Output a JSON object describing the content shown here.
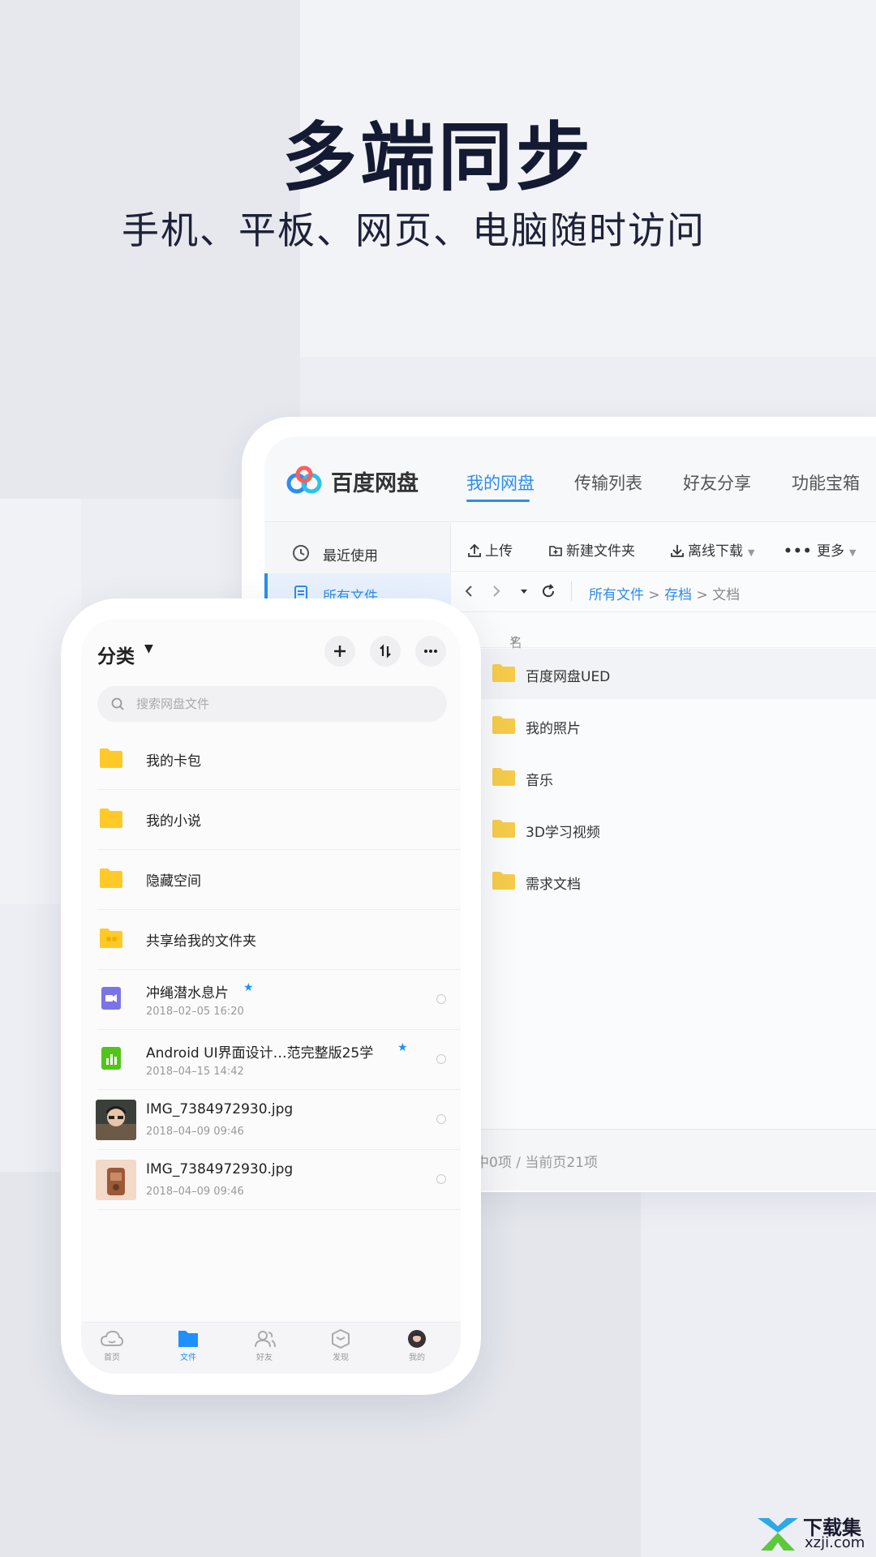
{
  "hero": {
    "title": "多端同步",
    "subtitle": "手机、平板、网页、电脑随时访问"
  },
  "desktop": {
    "app_name": "百度网盘",
    "nav": [
      "我的网盘",
      "传输列表",
      "好友分享",
      "功能宝箱"
    ],
    "active_nav": "我的网盘",
    "sidebar": [
      {
        "label": "最近使用",
        "icon": "clock-icon"
      },
      {
        "label": "所有文件",
        "icon": "document-icon",
        "active": true
      }
    ],
    "toolbar": {
      "upload": "上传",
      "new_folder": "新建文件夹",
      "offline_download": "离线下载",
      "more": "更多"
    },
    "breadcrumb": {
      "root": "所有文件",
      "sep1": ">",
      "mid": "存档",
      "sep2": ">",
      "current": "文档"
    },
    "column_name": "名称",
    "folders": [
      "百度网盘UED",
      "我的照片",
      "音乐",
      "3D学习视频",
      "需求文档"
    ],
    "footer": "中0项 / 当前页21项"
  },
  "phone": {
    "title": "分类",
    "search_placeholder": "搜索网盘文件",
    "folders": [
      "我的卡包",
      "我的小说",
      "隐藏空间",
      "共享给我的文件夹"
    ],
    "files": [
      {
        "name": "冲绳潜水息片",
        "date": "2018–02–05  16:20",
        "starred": true,
        "icon": "video-file-icon"
      },
      {
        "name": "Android UI界面设计…范完整版25学",
        "date": "2018–04–15  14:42",
        "starred": true,
        "icon": "sheet-file-icon"
      },
      {
        "name": "IMG_7384972930.jpg",
        "date": "2018–04–09  09:46",
        "starred": false,
        "icon": "photo-thumbnail"
      },
      {
        "name": "IMG_7384972930.jpg",
        "date": "2018–04–09  09:46",
        "starred": false,
        "icon": "photo-thumbnail"
      }
    ],
    "tabs": [
      {
        "label": "首页",
        "icon": "cloud-icon"
      },
      {
        "label": "文件",
        "icon": "folder-icon",
        "active": true
      },
      {
        "label": "好友",
        "icon": "friends-icon"
      },
      {
        "label": "发现",
        "icon": "discover-icon"
      },
      {
        "label": "我的",
        "icon": "avatar"
      }
    ]
  },
  "watermark": {
    "text1": "下载集",
    "text2": "xzji.com"
  },
  "colors": {
    "accent": "#2d8cf0",
    "folder": "#f7cc4a",
    "phone_accent": "#1e90ff"
  }
}
